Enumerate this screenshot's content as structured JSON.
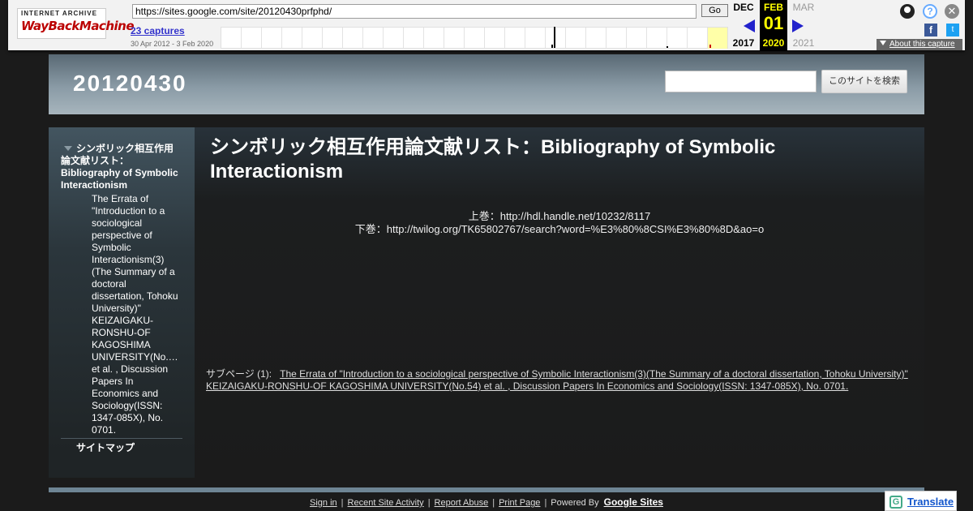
{
  "wayback": {
    "logo_top": "INTERNET ARCHIVE",
    "logo_main": "WayBackMachine",
    "url": "https://sites.google.com/site/20120430prfphd/",
    "go_label": "Go",
    "captures_label": "23 captures",
    "date_range": "30 Apr 2012 - 3 Feb 2020",
    "prev": {
      "month": "DEC",
      "year": "2017"
    },
    "current": {
      "month": "FEB",
      "day": "01",
      "year": "2020"
    },
    "next": {
      "month": "MAR",
      "year": "2021"
    },
    "about_label": "About this capture",
    "icons": [
      "user-icon",
      "help-icon",
      "close-icon",
      "facebook-icon",
      "twitter-icon"
    ]
  },
  "site": {
    "title": "20120430",
    "search_button": "このサイトを検索",
    "search_value": ""
  },
  "sidebar": {
    "parent": "シンボリック相互作用論文献リスト：Bibliography of Symbolic Interactionism",
    "child": "The Errata of \"Introduction to a sociological perspective of Symbolic Interactionism(3)(The Summary of a doctoral dissertation, Tohoku University)\" KEIZAIGAKU-RONSHU-OF KAGOSHIMA UNIVERSITY(No.… et al. , Discussion Papers In Economics and Sociology(ISSN: 1347-085X), No. 0701.",
    "sitemap": "サイトマップ"
  },
  "content": {
    "title": "シンボリック相互作用論文献リスト：Bibliography of Symbolic Interactionism",
    "line1": "上巻：http://hdl.handle.net/10232/8117",
    "line2": "下巻：http://twilog.org/TK65802767/search?word=%E3%80%8CSI%E3%80%8D&ao=o",
    "subpage_label": "サブページ (1):",
    "subpage_link": "The Errata of \"Introduction to a sociological perspective of Symbolic Interactionism(3)(The Summary of a doctoral dissertation, Tohoku University)\" KEIZAIGAKU-RONSHU-OF KAGOSHIMA UNIVERSITY(No.54) et al. , Discussion Papers In Economics and Sociology(ISSN: 1347-085X), No. 0701."
  },
  "footer": {
    "sign_in": "Sign in",
    "recent": "Recent Site Activity",
    "report": "Report Abuse",
    "print": "Print Page",
    "powered": "Powered By",
    "google_sites": "Google Sites",
    "translate": "Translate",
    "separator": "|"
  },
  "colors": {
    "accent_current": "#ffff00",
    "wayback_arrow": "#2222cc",
    "header_gradient_top": "#596974",
    "header_gradient_bottom": "#a7b5bd"
  }
}
